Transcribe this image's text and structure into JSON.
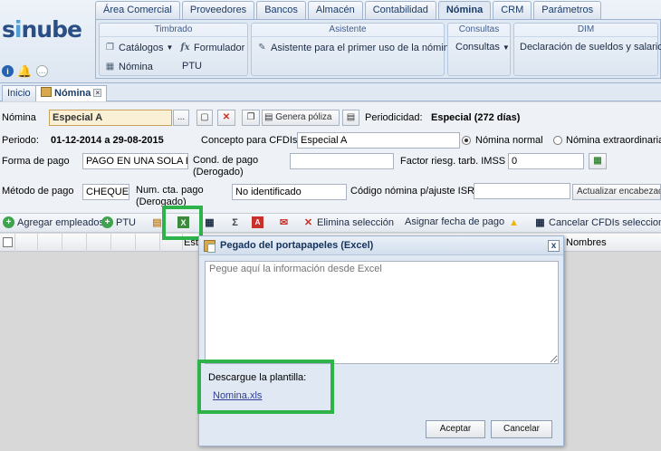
{
  "logo": {
    "main": "s",
    "accent": "i",
    "rest": "nube"
  },
  "main_tabs": [
    {
      "label": "Área Comercial"
    },
    {
      "label": "Proveedores"
    },
    {
      "label": "Bancos"
    },
    {
      "label": "Almacén"
    },
    {
      "label": "Contabilidad"
    },
    {
      "label": "Nómina"
    },
    {
      "label": "CRM"
    },
    {
      "label": "Parámetros"
    }
  ],
  "ribbon": {
    "timbrado": {
      "title": "Timbrado",
      "catalogos": "Catálogos",
      "formulador": "Formulador",
      "nomina": "Nómina",
      "ptu": "PTU"
    },
    "asistente": {
      "title": "Asistente",
      "primer_uso": "Asistente para el primer uso de la nómina"
    },
    "consultas": {
      "title": "Consultas",
      "consultas": "Consultas"
    },
    "dim": {
      "title": "DIM",
      "declaracion": "Declaración de sueldos y salarios"
    }
  },
  "doc_tabs": [
    {
      "label": "Inicio"
    },
    {
      "label": "Nómina"
    }
  ],
  "form": {
    "nomina_label": "Nómina",
    "nomina_value": "Especial A",
    "ellipsis": "...",
    "genera_poliza": "Genera póliza",
    "periodicidad_label": "Periodicidad:",
    "periodicidad_value": "Especial (272 días)",
    "periodo_label": "Periodo:",
    "periodo_value": "01-12-2014 a 29-08-2015",
    "concepto_label": "Concepto para CFDIs",
    "concepto_value": "Especial A",
    "nomina_normal": "Nómina normal",
    "nomina_extra": "Nómina extraordinaria",
    "forma_pago_label": "Forma de pago",
    "forma_pago_value": "PAGO EN UNA SOLA EX",
    "cond_pago_label": "Cond. de pago",
    "derogado": "(Derogado)",
    "factor_label": "Factor riesg. tarb. IMSS",
    "factor_value": "0",
    "metodo_label": "Método de pago",
    "metodo_value": "CHEQUE",
    "num_cta_label": "Num. cta. pago",
    "num_cta_value": "No identificado",
    "codigo_label": "Código nómina p/ajuste ISR",
    "actualizar": "Actualizar encabezado"
  },
  "toolbar": {
    "agregar": "Agregar empleados",
    "ptu": "PTU",
    "sigma": "Σ",
    "elimina": "Elimina selección",
    "asignar": "Asignar fecha de pago",
    "cancelar": "Cancelar CFDIs seleccionados"
  },
  "grid": {
    "col_estado": "Esta",
    "col_nombres": "Nombres"
  },
  "dialog": {
    "title": "Pegado del portapapeles (Excel)",
    "close": "x",
    "placeholder": "Pegue aquí la información desde Excel",
    "descargue": "Descargue la plantilla:",
    "link": "Nomina.xls",
    "aceptar": "Aceptar",
    "cancelar": "Cancelar"
  },
  "colors": {
    "highlight": "#2db34a",
    "brand": "#2a4f86"
  }
}
